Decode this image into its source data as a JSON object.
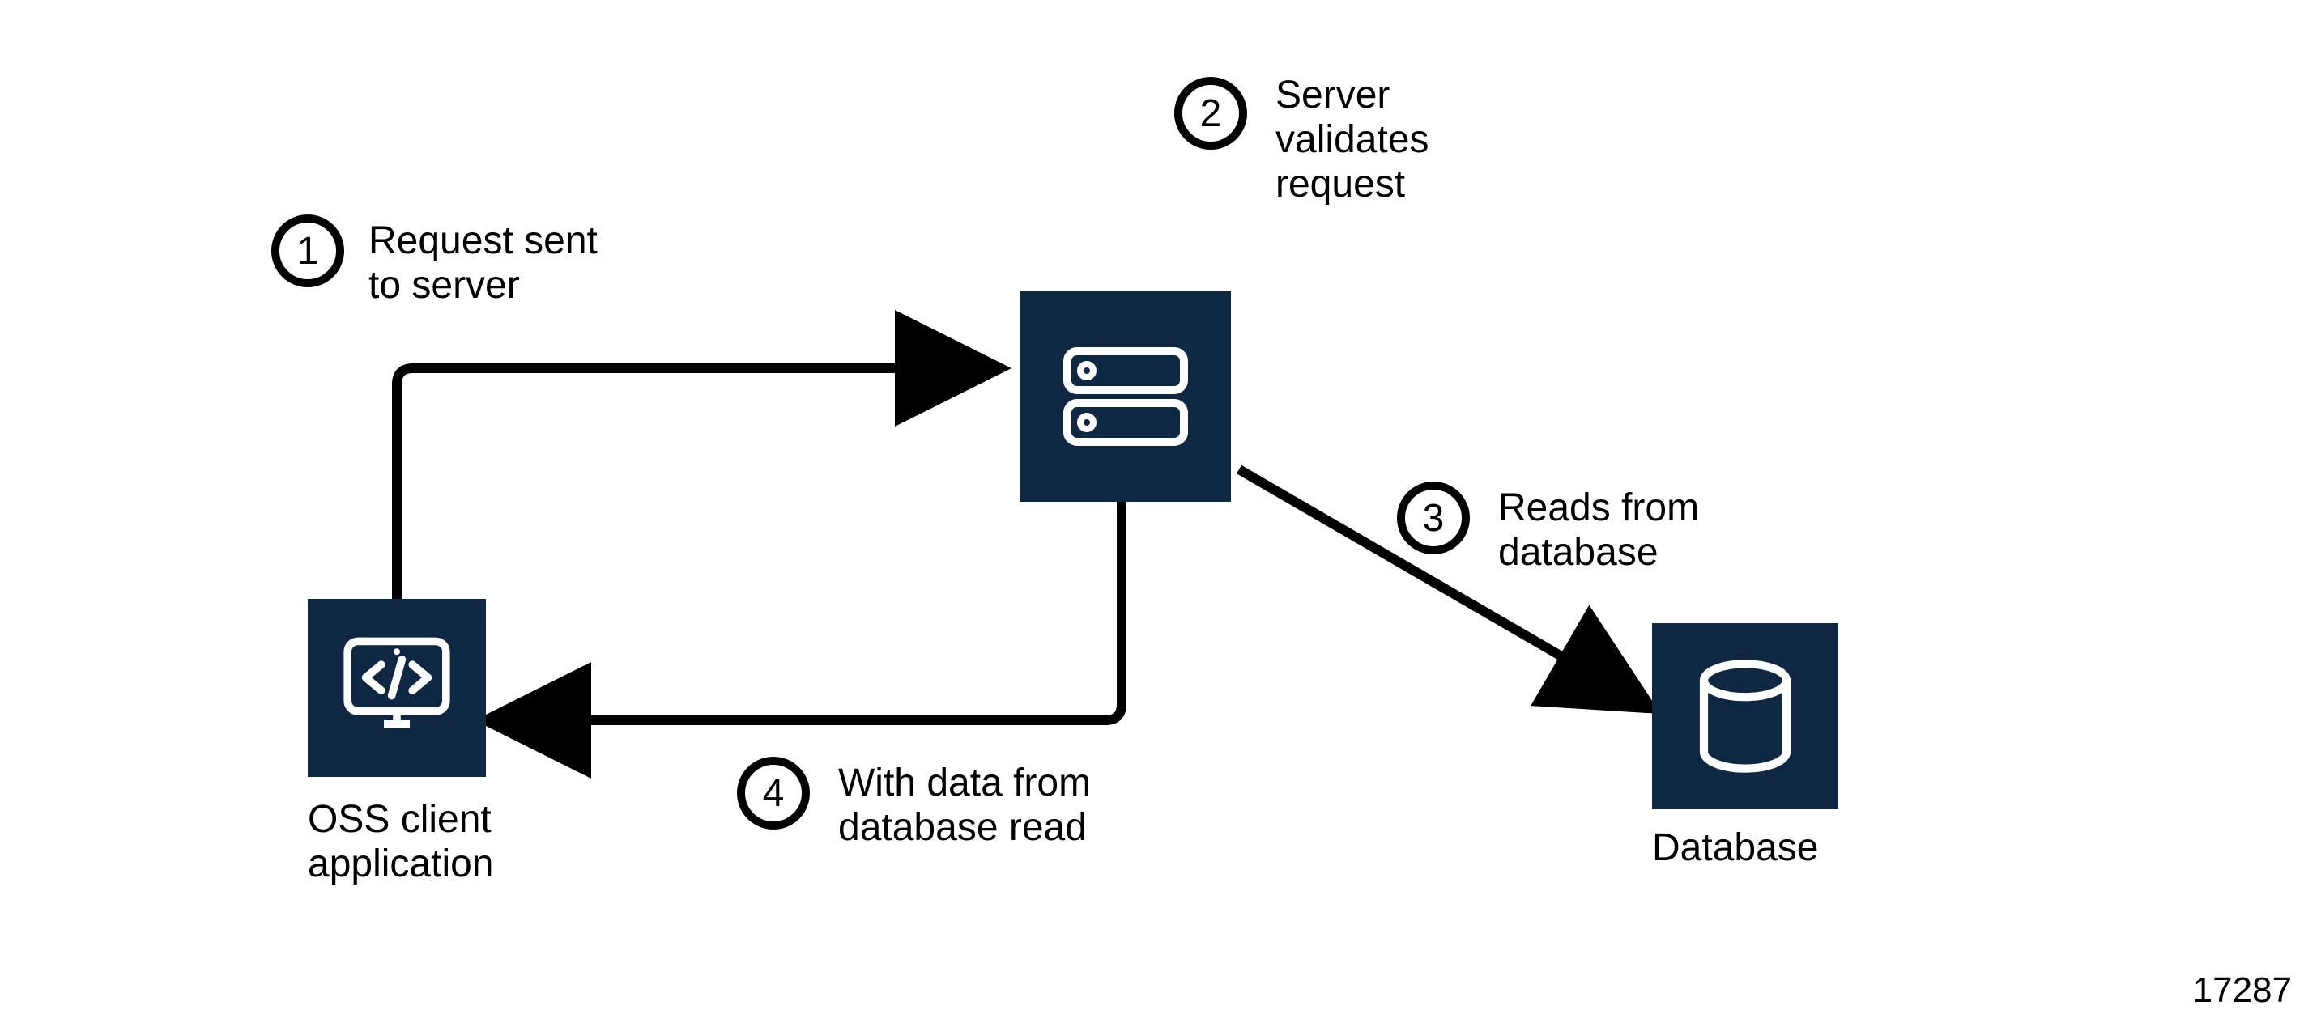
{
  "diagram_id": "17287",
  "nodes": {
    "client": {
      "label": "OSS client\napplication"
    },
    "server": {
      "label": ""
    },
    "database": {
      "label": "Database"
    }
  },
  "steps": [
    {
      "num": "1",
      "text": "Request sent\nto server"
    },
    {
      "num": "2",
      "text": "Server\nvalidates\nrequest"
    },
    {
      "num": "3",
      "text": "Reads from\ndatabase"
    },
    {
      "num": "4",
      "text": "With data from\ndatabase read"
    }
  ],
  "colors": {
    "node_bg": "#0e2843",
    "stroke": "#000000"
  }
}
